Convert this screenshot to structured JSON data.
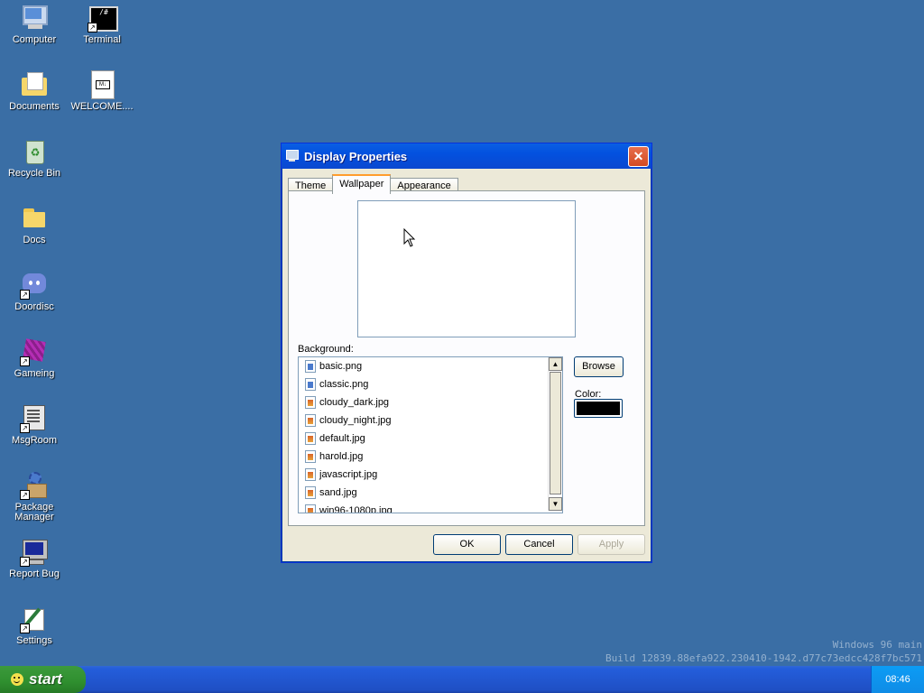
{
  "desktop": {
    "icons": [
      {
        "label": "Computer",
        "icon": "computer-icon"
      },
      {
        "label": "Terminal",
        "icon": "terminal-icon"
      },
      {
        "label": "Documents",
        "icon": "documents-icon"
      },
      {
        "label": "WELCOME....",
        "icon": "markdown-file-icon"
      },
      {
        "label": "Recycle Bin",
        "icon": "recycle-bin-icon"
      },
      {
        "label": "Docs",
        "icon": "folder-icon"
      },
      {
        "label": "Doordisc",
        "icon": "doordisc-icon"
      },
      {
        "label": "Gameing",
        "icon": "cube-icon"
      },
      {
        "label": "MsgRoom",
        "icon": "msgroom-icon"
      },
      {
        "label": "Package Manager",
        "icon": "package-manager-icon"
      },
      {
        "label": "Report Bug",
        "icon": "report-bug-icon"
      },
      {
        "label": "Settings",
        "icon": "settings-icon"
      }
    ],
    "watermark_line1": "Windows 96 main",
    "watermark_line2": "Build 12839.88efa922.230410-1942.d77c73edcc428f7bc571"
  },
  "window": {
    "title": "Display Properties",
    "close_glyph": "✕",
    "tabs": [
      "Theme",
      "Wallpaper",
      "Appearance"
    ],
    "active_tab": "Wallpaper",
    "background_label": "Background:",
    "files": [
      "basic.png",
      "classic.png",
      "cloudy_dark.jpg",
      "cloudy_night.jpg",
      "default.jpg",
      "harold.jpg",
      "javascript.jpg",
      "sand.jpg",
      "win96-1080p.jpg"
    ],
    "browse_label": "Browse",
    "color_label": "Color:",
    "color_value": "#000000",
    "ok_label": "OK",
    "cancel_label": "Cancel",
    "apply_label": "Apply",
    "scroll_up": "▲",
    "scroll_down": "▼"
  },
  "taskbar": {
    "start_label": "start",
    "clock": "08:46"
  },
  "colors": {
    "desktop": "#3a6ea5",
    "titlebar": "#0351df",
    "taskbar": "#245edb",
    "start": "#2f8f2f"
  }
}
